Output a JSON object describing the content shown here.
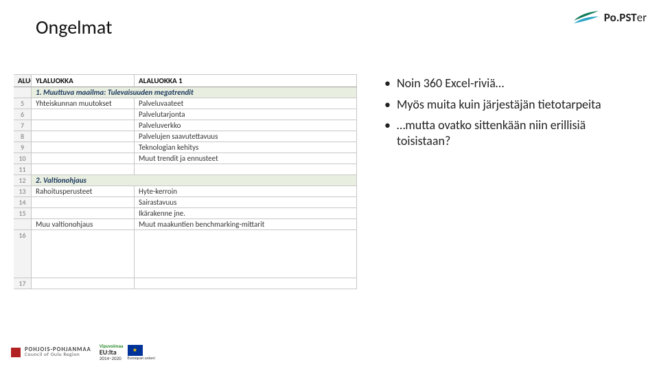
{
  "title": "Ongelmat",
  "logo": {
    "textA": "Po.",
    "textB": "PST",
    "textC": "er"
  },
  "excel": {
    "headers": {
      "col0": "ALUOKKA",
      "col1": "YLALUOKKA",
      "col2": "ALALUOKKA 1"
    },
    "rows": [
      {
        "n": "",
        "section": true,
        "c1": "1. Muuttuva maailma: Tulevaisuuden megatrendit",
        "c2": ""
      },
      {
        "n": "5",
        "c1": "Yhteiskunnan muutokset",
        "c2": "Palveluvaateet"
      },
      {
        "n": "6",
        "c1": "",
        "c2": "Palvelutarjonta"
      },
      {
        "n": "7",
        "c1": "",
        "c2": "Palveluverkko"
      },
      {
        "n": "8",
        "c1": "",
        "c2": "Palvelujen saavutettavuus"
      },
      {
        "n": "9",
        "c1": "",
        "c2": "Teknologian kehitys"
      },
      {
        "n": "10",
        "c1": "",
        "c2": "Muut trendit ja ennusteet"
      },
      {
        "n": "11",
        "c1": "",
        "c2": ""
      },
      {
        "n": "12",
        "section": true,
        "c1": "2. Valtionohjaus",
        "c2": ""
      },
      {
        "n": "13",
        "c1": "Rahoitusperusteet",
        "c2": "Hyte-kerroin"
      },
      {
        "n": "14",
        "c1": "",
        "c2": "Sairastavuus"
      },
      {
        "n": "15",
        "c1": "",
        "c2": "Ikärakenne jne."
      },
      {
        "n": "",
        "c1": "Muu valtionohjaus",
        "c2": "Muut maakuntien benchmarking-mittarit"
      },
      {
        "n": "16",
        "tall": true,
        "c1": "",
        "c2": ""
      },
      {
        "n": "17",
        "c1": "",
        "c2": ""
      }
    ]
  },
  "bullets": [
    "Noin 360 Excel-riviä…",
    "Myös muita kuin järjestäjän tietotarpeita",
    "…mutta ovatko sittenkään niin erillisiä toisistaan?"
  ],
  "footer": {
    "pp1": "POHJOIS-POHJANMAA",
    "pp2": "Council of Oulu Region",
    "vipu1": "Vipuvoimaa",
    "vipu2": "EU:lta",
    "vipu3": "2014–2020",
    "euCap": "Euroopan unioni"
  }
}
